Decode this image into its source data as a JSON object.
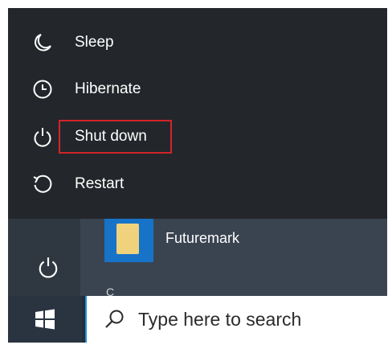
{
  "power_menu": {
    "items": [
      {
        "label": "Sleep",
        "icon": "sleep-moon-icon"
      },
      {
        "label": "Hibernate",
        "icon": "hibernate-clock-icon"
      },
      {
        "label": "Shut down",
        "icon": "power-icon",
        "highlighted": true
      },
      {
        "label": "Restart",
        "icon": "restart-icon"
      }
    ],
    "highlight_color": "#d2232a"
  },
  "start_list": {
    "app_name": "Futuremark",
    "app_icon": "folder-icon",
    "next_section_letter": "C",
    "rail_icon": "power-icon"
  },
  "taskbar": {
    "start_icon": "windows-logo-icon",
    "search_placeholder": "Type here to search",
    "search_icon": "search-icon",
    "accent": "#1a8fe0"
  }
}
